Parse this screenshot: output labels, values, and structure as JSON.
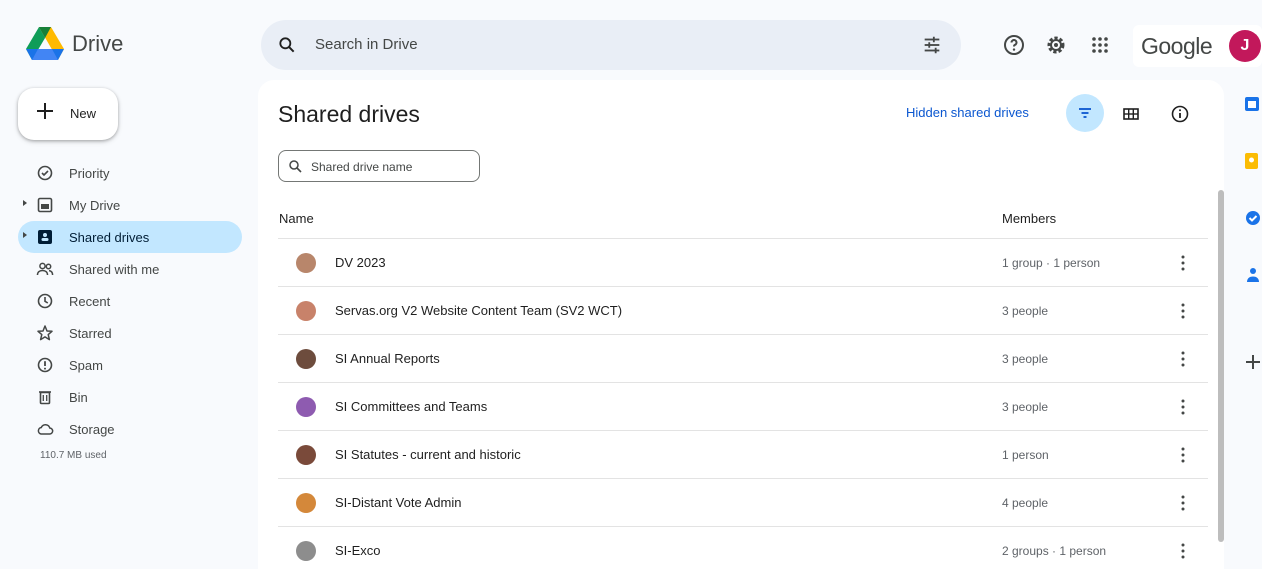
{
  "app": {
    "name": "Drive",
    "brand": "Google",
    "user_initial": "J",
    "avatar_color": "#c2185b",
    "accent": "#0b57d0",
    "active_bg": "#c2e7ff"
  },
  "search": {
    "placeholder": "Search in Drive"
  },
  "sidebar": {
    "new_label": "New",
    "items": [
      {
        "label": "Priority",
        "icon": "priority-icon"
      },
      {
        "label": "My Drive",
        "icon": "my-drive-icon"
      },
      {
        "label": "Shared drives",
        "icon": "shared-drives-icon",
        "active": true
      },
      {
        "label": "Shared with me",
        "icon": "people-icon"
      },
      {
        "label": "Recent",
        "icon": "clock-icon"
      },
      {
        "label": "Starred",
        "icon": "star-icon"
      },
      {
        "label": "Spam",
        "icon": "spam-icon"
      },
      {
        "label": "Bin",
        "icon": "bin-icon"
      },
      {
        "label": "Storage",
        "icon": "cloud-icon"
      }
    ],
    "storage_used": "110.7 MB used"
  },
  "main": {
    "title": "Shared drives",
    "hidden_link": "Hidden shared drives",
    "drive_search_placeholder": "Shared drive name",
    "columns": {
      "name": "Name",
      "members": "Members"
    },
    "rows": [
      {
        "name": "DV 2023",
        "members": "1 group · 1 person",
        "thumb": "#b8866b"
      },
      {
        "name": "Servas.org V2 Website Content Team (SV2 WCT)",
        "members": "3 people",
        "thumb": "#c8826a"
      },
      {
        "name": "SI Annual Reports",
        "members": "3 people",
        "thumb": "#6d4c3d"
      },
      {
        "name": "SI Committees and Teams",
        "members": "3 people",
        "thumb": "#8e5bb0"
      },
      {
        "name": "SI Statutes - current and historic",
        "members": "1 person",
        "thumb": "#7a4a3a"
      },
      {
        "name": "SI-Distant Vote Admin",
        "members": "4 people",
        "thumb": "#d4883a"
      },
      {
        "name": "SI-Exco",
        "members": "2 groups · 1 person",
        "thumb": "#8d8d8d"
      }
    ]
  }
}
